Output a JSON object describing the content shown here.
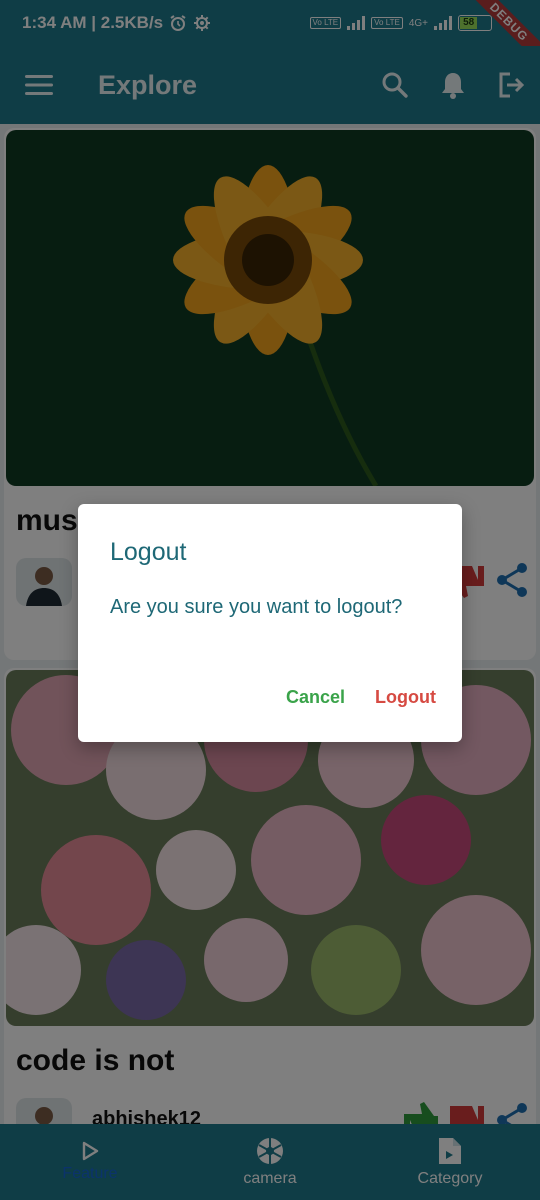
{
  "status_bar": {
    "time_text": "1:34 AM | 2.5KB/s",
    "network": "4G+",
    "battery": "58",
    "volte": "Vo LTE",
    "debug_label": "DEBUG"
  },
  "app_bar": {
    "title": "Explore",
    "icons": [
      "menu-icon",
      "search-icon",
      "bell-icon",
      "logout-icon"
    ]
  },
  "posts": [
    {
      "caption": "mus",
      "username": "",
      "image": "orange-flower-photo"
    },
    {
      "caption": "code is not",
      "username": "abhishek12",
      "image": "rose-bouquet-photo"
    }
  ],
  "bottom_nav": {
    "items": [
      {
        "label": "Feature",
        "icon": "play-icon",
        "active": true
      },
      {
        "label": "camera",
        "icon": "camera-shutter-icon",
        "active": false
      },
      {
        "label": "Category",
        "icon": "document-video-icon",
        "active": false
      }
    ]
  },
  "dialog": {
    "title": "Logout",
    "message": "Are you sure you want to logout?",
    "cancel_label": "Cancel",
    "confirm_label": "Logout"
  },
  "colors": {
    "primary": "#1e7a8c",
    "dialog_text": "#1e6876",
    "cancel": "#3aa34a",
    "confirm": "#d64a42",
    "nav_active": "#1766d8"
  }
}
